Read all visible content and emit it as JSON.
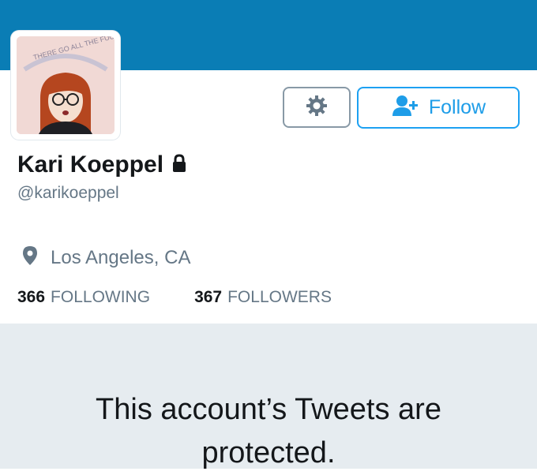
{
  "profile": {
    "avatar_badge_text": "THERE GO ALL THE FUCKS I GIVE",
    "display_name": "Kari Koeppel",
    "handle": "@karikoeppel",
    "protected_icon": "lock-icon",
    "location": "Los Angeles, CA"
  },
  "actions": {
    "settings_icon": "gear-icon",
    "follow_icon": "add-user-icon",
    "follow_label": "Follow"
  },
  "stats": {
    "following_count": "366",
    "following_label": "FOLLOWING",
    "followers_count": "367",
    "followers_label": "FOLLOWERS"
  },
  "protected_notice": {
    "line1": "This account’s Tweets are",
    "line2": "protected."
  },
  "colors": {
    "banner": "#0a7db5",
    "accent": "#1da1f2",
    "panel": "#e6ecf0"
  }
}
